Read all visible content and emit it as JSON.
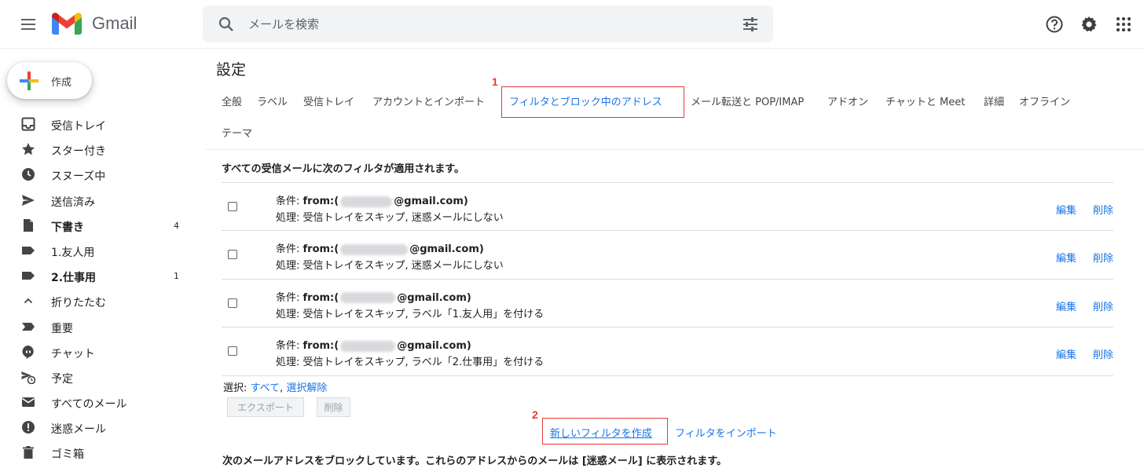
{
  "app": {
    "name": "Gmail"
  },
  "search": {
    "placeholder": "メールを検索"
  },
  "compose": {
    "label": "作成"
  },
  "sidebar": {
    "items": [
      {
        "label": "受信トレイ",
        "icon": "inbox-icon",
        "count": ""
      },
      {
        "label": "スター付き",
        "icon": "star-icon",
        "count": ""
      },
      {
        "label": "スヌーズ中",
        "icon": "clock-icon",
        "count": ""
      },
      {
        "label": "送信済み",
        "icon": "send-icon",
        "count": ""
      },
      {
        "label": "下書き",
        "icon": "draft-icon",
        "count": "4"
      },
      {
        "label": "1.友人用",
        "icon": "label-icon",
        "count": ""
      },
      {
        "label": "2.仕事用",
        "icon": "label-icon",
        "count": "1"
      },
      {
        "label": "折りたたむ",
        "icon": "chevron-up-icon",
        "count": ""
      },
      {
        "label": "重要",
        "icon": "important-icon",
        "count": ""
      },
      {
        "label": "チャット",
        "icon": "chat-icon",
        "count": ""
      },
      {
        "label": "予定",
        "icon": "scheduled-icon",
        "count": ""
      },
      {
        "label": "すべてのメール",
        "icon": "mail-icon",
        "count": ""
      },
      {
        "label": "迷惑メール",
        "icon": "spam-icon",
        "count": ""
      },
      {
        "label": "ゴミ箱",
        "icon": "trash-icon",
        "count": ""
      }
    ]
  },
  "settings": {
    "title": "設定",
    "tabs": [
      "全般",
      "ラベル",
      "受信トレイ",
      "アカウントとインポート",
      "フィルタとブロック中のアドレス",
      "メール転送と POP/IMAP",
      "アドオン",
      "チャットと Meet",
      "詳細",
      "オフライン",
      "テーマ"
    ],
    "filters_heading": "すべての受信メールに次のフィルタが適用されます。",
    "filters": [
      {
        "cond_prefix": "条件: ",
        "cond_from": "from:(",
        "cond_suffix": "@gmail.com)",
        "action": "処理: 受信トレイをスキップ, 迷惑メールにしない"
      },
      {
        "cond_prefix": "条件: ",
        "cond_from": "from:(",
        "cond_suffix": "@gmail.com)",
        "action": "処理: 受信トレイをスキップ, 迷惑メールにしない"
      },
      {
        "cond_prefix": "条件: ",
        "cond_from": "from:(",
        "cond_suffix": "@gmail.com)",
        "action": "処理: 受信トレイをスキップ, ラベル「1.友人用」を付ける"
      },
      {
        "cond_prefix": "条件: ",
        "cond_from": "from:(",
        "cond_suffix": "@gmail.com)",
        "action": "処理: 受信トレイをスキップ, ラベル「2.仕事用」を付ける"
      }
    ],
    "edit_label": "編集",
    "delete_label": "削除",
    "select_prefix": "選択: ",
    "select_all": "すべて",
    "select_none": "選択解除",
    "select_sep": ", ",
    "export_button": "エクスポート",
    "delete_button": "削除",
    "create_filter": "新しいフィルタを作成",
    "import_filter": "フィルタをインポート",
    "blocked_heading": "次のメールアドレスをブロックしています。これらのアドレスからのメールは [迷惑メール] に表示されます。"
  },
  "annotations": {
    "step1": "1",
    "step2": "2"
  },
  "colors": {
    "accent": "#1a73e8",
    "highlight": "#e53935"
  }
}
